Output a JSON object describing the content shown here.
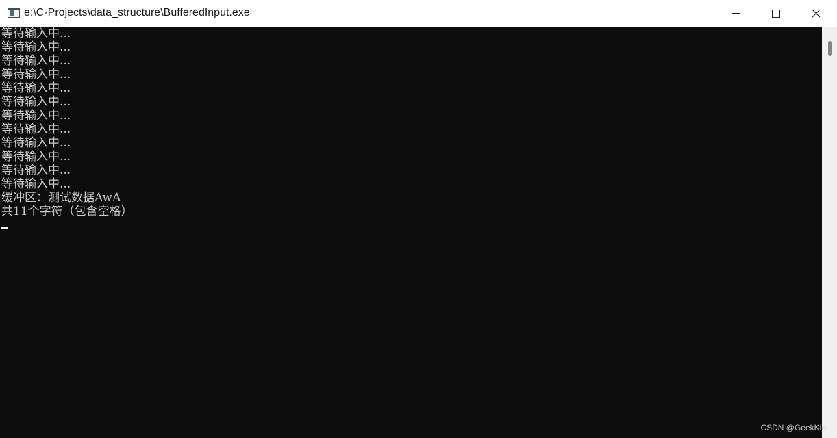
{
  "window": {
    "title": "e:\\C-Projects\\data_structure\\BufferedInput.exe",
    "icon": "console-app-icon",
    "controls": {
      "minimize": "minimize-icon",
      "maximize": "maximize-icon",
      "close": "close-icon"
    }
  },
  "console": {
    "lines": [
      "等待输入中...",
      "等待输入中...",
      "等待输入中...",
      "等待输入中...",
      "等待输入中...",
      "等待输入中...",
      "等待输入中...",
      "等待输入中...",
      "等待输入中...",
      "等待输入中...",
      "等待输入中...",
      "等待输入中...",
      "缓冲区：测试数据AwA",
      "共11个字符（包含空格）"
    ],
    "colors": {
      "background": "#0c0c0c",
      "text": "#cccccc"
    }
  },
  "watermark": "CSDN @GeekKid"
}
